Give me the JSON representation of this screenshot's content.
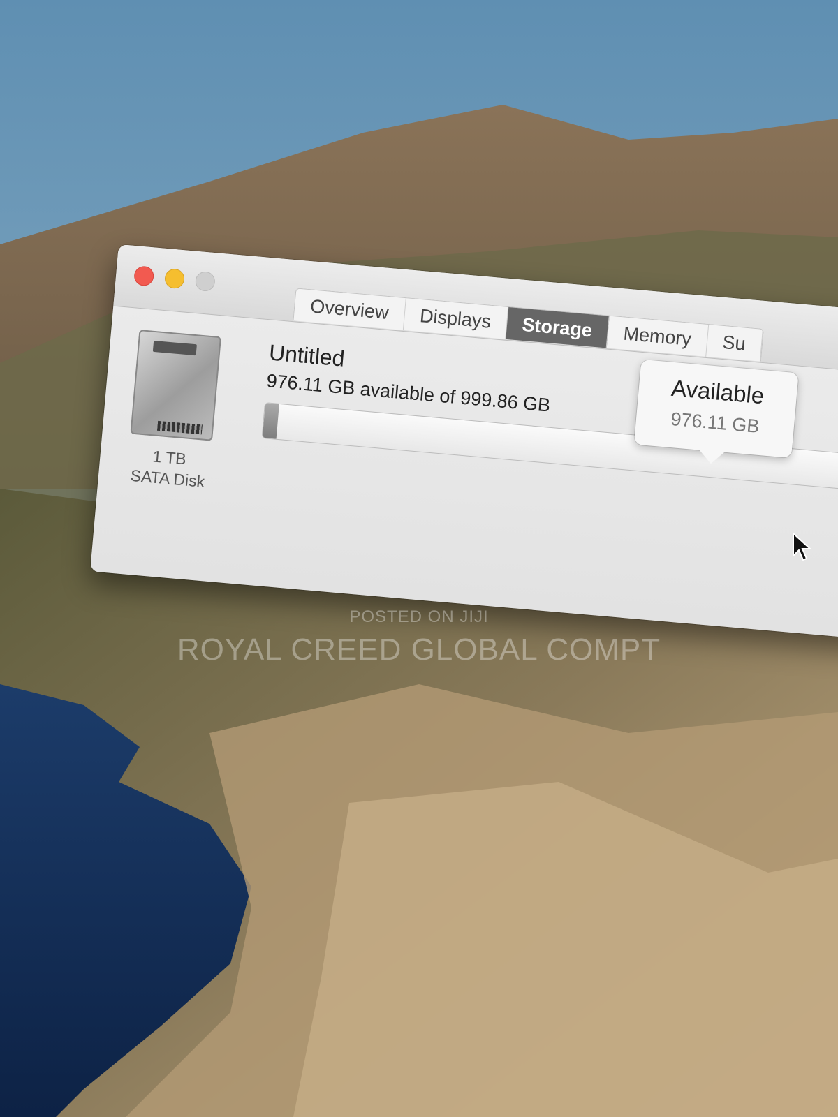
{
  "window": {
    "tabs": [
      {
        "label": "Overview",
        "active": false
      },
      {
        "label": "Displays",
        "active": false
      },
      {
        "label": "Storage",
        "active": true
      },
      {
        "label": "Memory",
        "active": false
      },
      {
        "label": "Su",
        "active": false
      }
    ]
  },
  "disk": {
    "icon": "hard-drive-icon",
    "size_label": "1 TB",
    "type_label": "SATA Disk"
  },
  "volume": {
    "name": "Untitled",
    "summary": "976.11 GB available of 999.86 GB",
    "used_fraction": 0.0238
  },
  "tooltip": {
    "title": "Available",
    "value": "976.11 GB"
  },
  "watermark": {
    "line1": "POSTED ON JIJI",
    "line2": "ROYAL CREED GLOBAL COMPT"
  },
  "colors": {
    "close": "#f25a50",
    "minimize": "#f5be2f",
    "zoom_disabled": "#cfcfcf",
    "active_tab": "#666666"
  }
}
